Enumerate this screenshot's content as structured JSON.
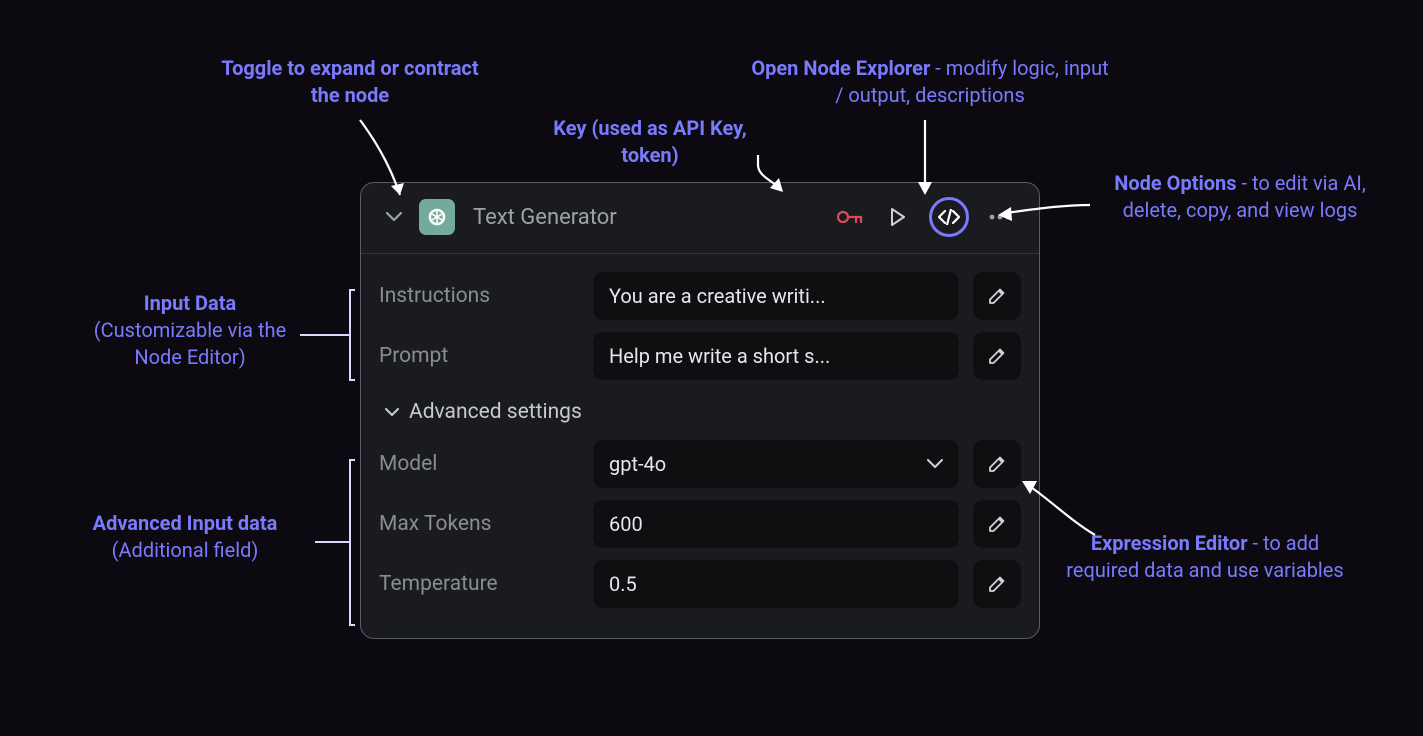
{
  "node": {
    "title": "Text Generator",
    "fields": {
      "instructions": {
        "label": "Instructions",
        "value": "You are a creative writi..."
      },
      "prompt": {
        "label": "Prompt",
        "value": "Help me write a short s..."
      }
    },
    "advanced": {
      "header": "Advanced settings",
      "model": {
        "label": "Model",
        "value": "gpt-4o"
      },
      "max_tokens": {
        "label": "Max Tokens",
        "value": "600"
      },
      "temperature": {
        "label": "Temperature",
        "value": "0.5"
      }
    }
  },
  "annotations": {
    "toggle": {
      "bold": "Toggle to expand or contract the node",
      "rest": ""
    },
    "key": {
      "bold": "Key (used as API Key, token)",
      "rest": ""
    },
    "explorer": {
      "bold": "Open Node Explorer",
      "rest": " - modify logic, input / output, descriptions"
    },
    "options": {
      "bold": "Node Options",
      "rest": " - to edit via AI, delete, copy, and view logs"
    },
    "input_data": {
      "bold": "Input Data",
      "rest": "(Customizable via the Node Editor)"
    },
    "adv_input": {
      "bold": "Advanced Input data",
      "rest": "(Additional field)"
    },
    "expr_editor": {
      "bold": "Expression Editor",
      "rest": " - to add required data and use variables"
    }
  }
}
